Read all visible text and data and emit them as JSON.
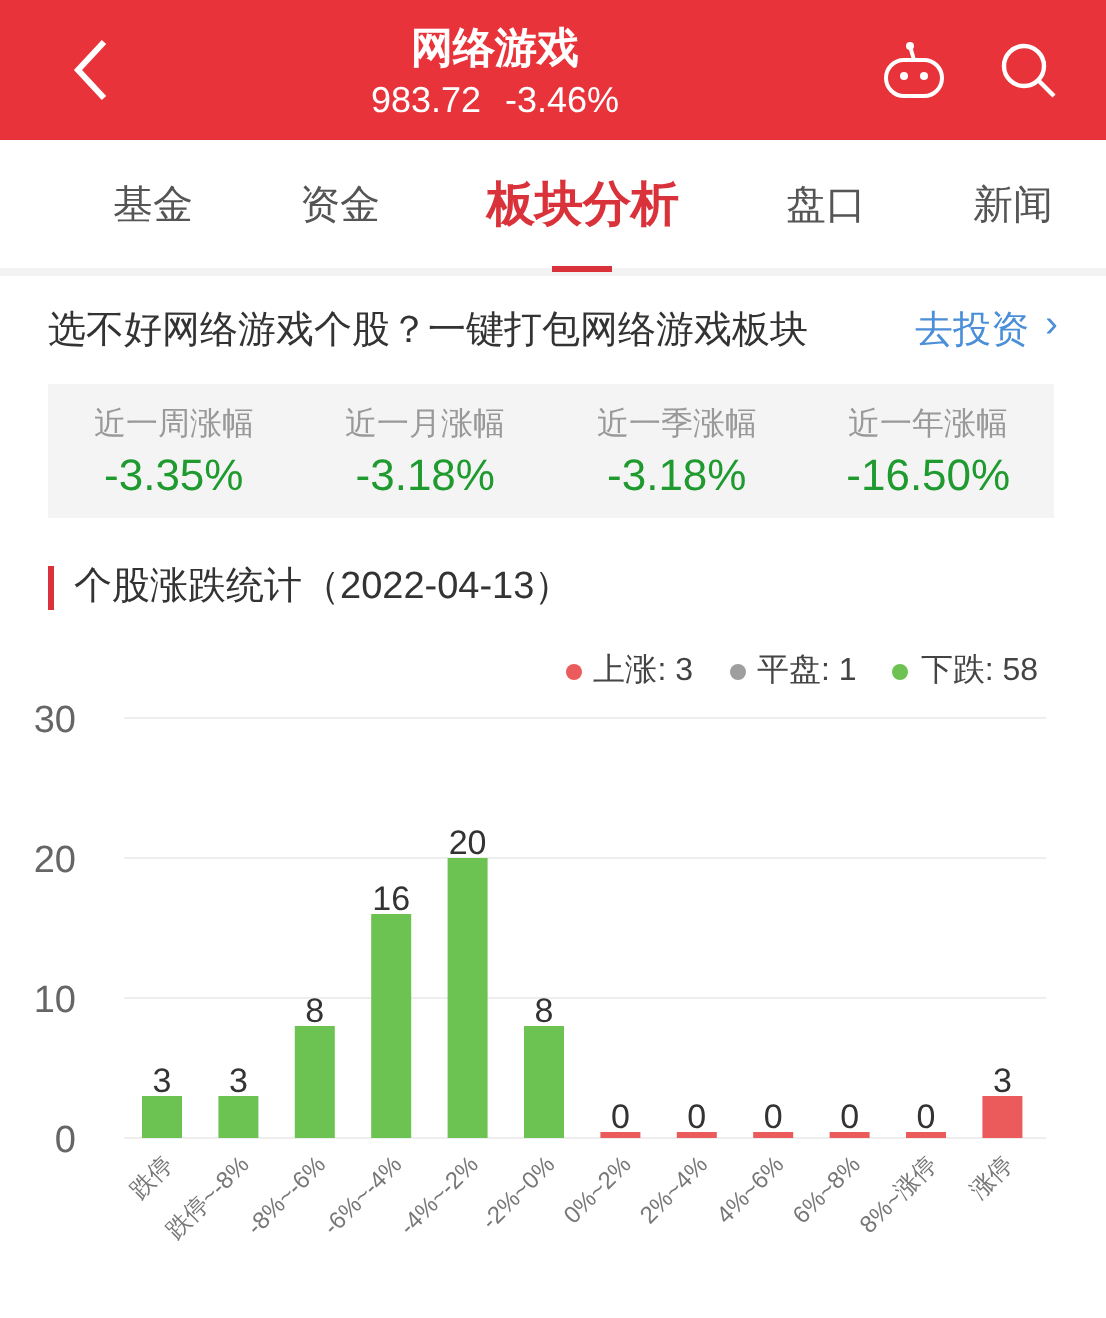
{
  "header": {
    "title": "网络游戏",
    "price": "983.72",
    "change": "-3.46%"
  },
  "tabs": [
    {
      "label": "基金",
      "selected": false
    },
    {
      "label": "资金",
      "selected": false
    },
    {
      "label": "板块分析",
      "selected": true
    },
    {
      "label": "盘口",
      "selected": false
    },
    {
      "label": "新闻",
      "selected": false
    }
  ],
  "promo": {
    "text": "选不好网络游戏个股？一键打包网络游戏板块",
    "link": "去投资",
    "arrow": "›"
  },
  "stats": [
    {
      "label": "近一周涨幅",
      "value": "-3.35%"
    },
    {
      "label": "近一月涨幅",
      "value": "-3.18%"
    },
    {
      "label": "近一季涨幅",
      "value": "-3.18%"
    },
    {
      "label": "近一年涨幅",
      "value": "-16.50%"
    }
  ],
  "section": {
    "title": "个股涨跌统计（2022-04-13）"
  },
  "legend": [
    {
      "label": "上涨: 3",
      "color": "#ec5b5b"
    },
    {
      "label": "平盘: 1",
      "color": "#9e9e9e"
    },
    {
      "label": "下跌: 58",
      "color": "#6cc352"
    }
  ],
  "chart_data": {
    "type": "bar",
    "categories": [
      "跌停",
      "跌停~-8%",
      "-8%~-6%",
      "-6%~-4%",
      "-4%~-2%",
      "-2%~0%",
      "0%~2%",
      "2%~4%",
      "4%~6%",
      "6%~8%",
      "8%~涨停",
      "涨停"
    ],
    "series": [
      {
        "color": "#6cc352",
        "values": [
          3,
          3,
          8,
          16,
          20,
          8,
          null,
          null,
          null,
          null,
          null,
          null
        ]
      },
      {
        "color": "#ec5b5b",
        "values": [
          null,
          null,
          null,
          null,
          null,
          null,
          0,
          0,
          0,
          0,
          0,
          3
        ]
      }
    ],
    "ylim": [
      0,
      30
    ],
    "yticks": [
      0,
      10,
      20,
      30
    ],
    "data_labels": true
  }
}
